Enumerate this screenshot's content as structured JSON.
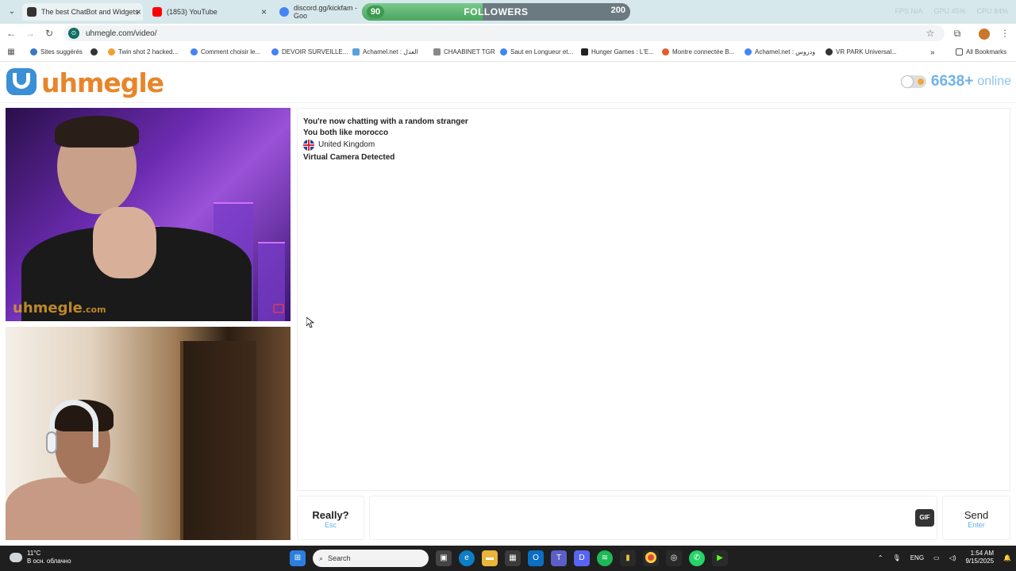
{
  "browser": {
    "tabs": [
      {
        "title": "The best ChatBot and Widgets",
        "favicon_color": "#333333"
      },
      {
        "title": "(1853) YouTube",
        "favicon_color": "#ff0000"
      },
      {
        "title": "discord.gg/kickfam - Goo",
        "favicon_color": "#4285f4"
      }
    ],
    "followers_overlay": {
      "current": "90",
      "label": "FOLLOWERS",
      "goal": "200",
      "progress_fraction": 0.45
    },
    "stats": [
      "FPS N/A",
      "GPU 45%",
      "CPU 84%"
    ],
    "url": "uhmegle.com/video/",
    "bookmarks": [
      "Sites suggérés",
      "Twin shot 2 hacked...",
      "Comment choisir le...",
      "DEVOIR SURVEILLE...",
      "Achamel.net : العدل",
      "CHAABINET TGR",
      "Saut en Longueur et...",
      "Hunger Games : L'E...",
      "Montre connectée B...",
      "Achamel.net : ودروس",
      "VR PARK Universal..."
    ],
    "all_bookmarks": "All Bookmarks"
  },
  "site": {
    "logo_text": "uhmegle",
    "online_count": "6638+",
    "online_label": "online",
    "brand_color": "#e8852a",
    "accent_color": "#3b8fd6"
  },
  "stranger_video": {
    "watermark": "uhmegle",
    "watermark_suffix": ".com"
  },
  "chat": {
    "status": "You're now chatting with a random stranger",
    "interest": "You both like morocco",
    "country": "United Kingdom",
    "warning": "Virtual Camera Detected"
  },
  "controls": {
    "stop_label": "Really?",
    "stop_hint": "Esc",
    "gif_label": "GIF",
    "send_label": "Send",
    "send_hint": "Enter"
  },
  "taskbar": {
    "temperature": "11°C",
    "weather": "В осн. облачно",
    "search_placeholder": "Search",
    "language": "ENG",
    "time": "1:54 AM",
    "date": "9/15/2025"
  }
}
